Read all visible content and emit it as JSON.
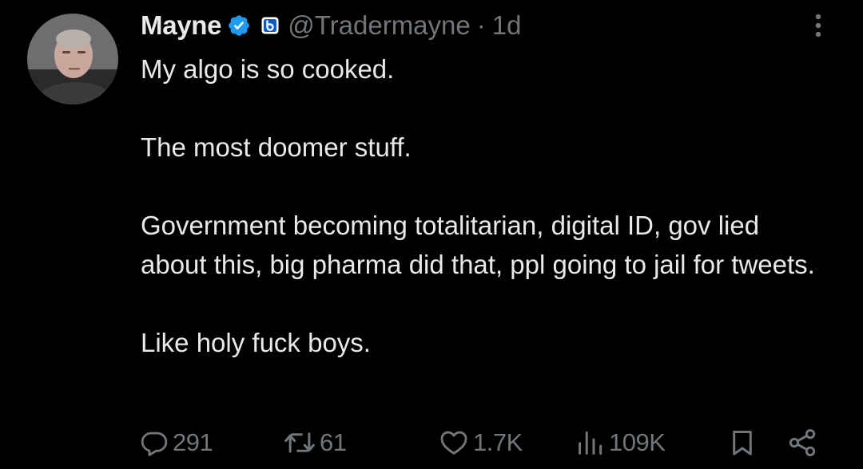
{
  "tweet": {
    "author": {
      "display_name": "Mayne",
      "handle": "@Tradermayne",
      "verified": true,
      "verified_icon": "verified-badge-icon",
      "affiliate_icon": "affiliate-badge-icon"
    },
    "separator": "·",
    "timestamp": "1d",
    "body": {
      "line1": "My algo is so cooked.",
      "line2": "The most doomer stuff.",
      "line3": "Government becoming totalitarian, digital ID, gov lied about this, big pharma did that, ppl going to jail for tweets.",
      "line4": "Like holy fuck boys."
    },
    "metrics": {
      "replies": "291",
      "reposts": "61",
      "likes": "1.7K",
      "views": "109K"
    }
  },
  "icons": {
    "more": "more-options-icon",
    "reply": "reply-icon",
    "repost": "repost-icon",
    "like": "like-icon",
    "views": "views-icon",
    "bookmark": "bookmark-icon",
    "share": "share-icon"
  },
  "colors": {
    "background": "#000000",
    "text": "#e7e9ea",
    "muted": "#71767b",
    "verified_blue": "#1d9bf0"
  }
}
